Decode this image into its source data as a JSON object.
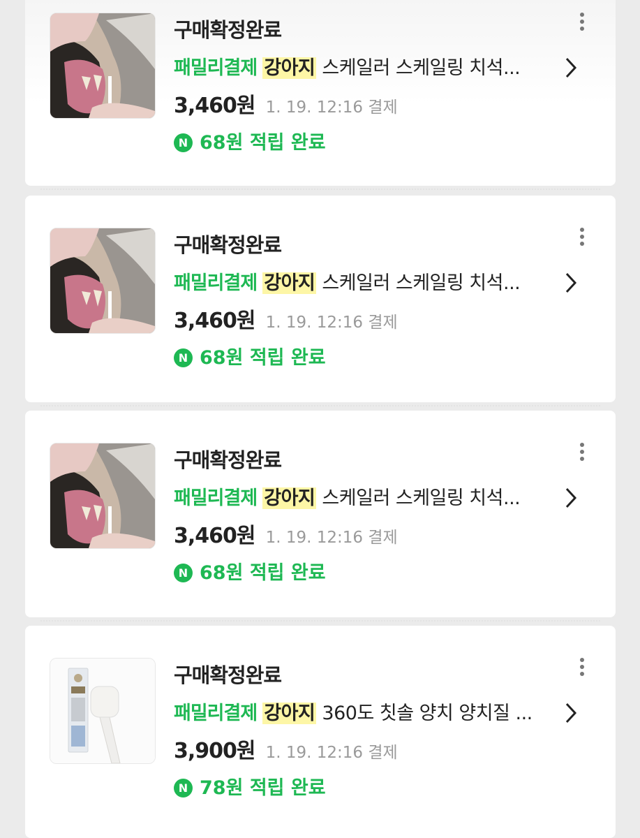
{
  "orders": [
    {
      "status": "구매확정완료",
      "family_label": "패밀리결제",
      "keyword": "강아지",
      "product_name": "스케일러 스케일링 치석...",
      "price": "3,460원",
      "date": "1. 19. 12:16 결제",
      "reward": "68원 적립 완료",
      "thumbnail": "dog-teeth-scaling-photo"
    },
    {
      "status": "구매확정완료",
      "family_label": "패밀리결제",
      "keyword": "강아지",
      "product_name": "스케일러 스케일링 치석...",
      "price": "3,460원",
      "date": "1. 19. 12:16 결제",
      "reward": "68원 적립 완료",
      "thumbnail": "dog-teeth-scaling-photo"
    },
    {
      "status": "구매확정완료",
      "family_label": "패밀리결제",
      "keyword": "강아지",
      "product_name": "스케일러 스케일링 치석...",
      "price": "3,460원",
      "date": "1. 19. 12:16 결제",
      "reward": "68원 적립 완료",
      "thumbnail": "dog-teeth-scaling-photo"
    },
    {
      "status": "구매확정완료",
      "family_label": "패밀리결제",
      "keyword": "강아지",
      "product_name": "360도 칫솔 양치 양치질 ...",
      "price": "3,900원",
      "date": "1. 19. 12:16 결제",
      "reward": "78원 적립 완료",
      "thumbnail": "toothbrush-package-photo"
    }
  ],
  "npay_icon_text": "N",
  "colors": {
    "accent_green": "#1eb853",
    "highlight": "#fdf6a6"
  },
  "icons": {
    "more": "more-vertical-icon",
    "chevron": "chevron-right-icon",
    "points": "npay-point-icon"
  }
}
